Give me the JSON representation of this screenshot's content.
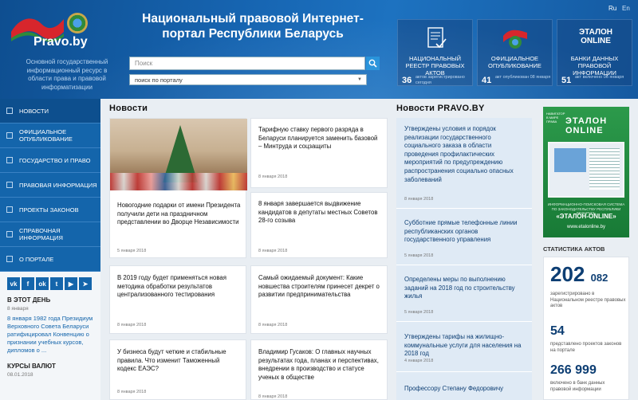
{
  "header": {
    "logo_name": "Pravo.by",
    "tagline": "Основной государственный информационный ресурс в области права и правовой информатизации",
    "title": "Национальный правовой Интернет-портал Республики Беларусь",
    "search_placeholder": "Поиск",
    "search_mode": "поиск по порталу",
    "lang_ru": "Ru",
    "lang_en": "En",
    "tiles": [
      {
        "label": "Национальный реестр правовых актов",
        "num": "36",
        "desc": "актов зарегистрировано сегодня",
        "icon": "registry-document-icon"
      },
      {
        "label": "Официальное опубликование",
        "num": "41",
        "desc": "акт опубликован 08 января",
        "icon": "official-emblem-icon"
      },
      {
        "label": "Банки данных правовой информации",
        "num": "51",
        "desc": "акт включено 06 января",
        "icon": "etalon-logo-icon",
        "logo_text": "ЭТАЛОН ONLINE"
      }
    ]
  },
  "sidebar": {
    "nav": [
      "Новости",
      "Официальное опубликование",
      "Государство и право",
      "Правовая информация",
      "Проекты законов",
      "Справочная информация",
      "О портале"
    ],
    "social": [
      "vk",
      "f",
      "ok",
      "tw",
      "yt",
      "tg"
    ],
    "today_h": "В этот день",
    "today_date": "8 января",
    "today_text": "8 января 1982 года Президиум Верховного Совета Беларуси ратифицировал Конвенцию о признании учебных курсов, дипломов о ...",
    "rates_h": "Курсы валют",
    "rates_date": "08.01.2018"
  },
  "news": {
    "heading": "Новости",
    "cards": [
      {
        "text": "Новогодние подарки от имени Президента получили дети на праздничном представлении во Дворце Независимости",
        "date": "5 января 2018"
      },
      {
        "text": "Тарифную ставку первого разряда в Беларуси планируется заменить базовой – Минтруда и соцзащиты",
        "date": "8 января 2018"
      },
      {
        "text": "8 января завершается выдвижение кандидатов в депутаты местных Советов 28-го созыва",
        "date": "8 января 2018"
      },
      {
        "text": "В 2019 году будет применяться новая методика обработки результатов централизованного тестирования",
        "date": "8 января 2018"
      },
      {
        "text": "Самый ожидаемый документ: Какие новшества строителям принесет декрет о развитии предпринимательства",
        "date": "8 января 2018"
      },
      {
        "text": "У бизнеса будут четкие и стабильные правила. Что изменит Таможенный кодекс ЕАЭС?",
        "date": "8 января 2018"
      },
      {
        "text": "Владимир Гусаков: О главных научных результатах года, планах и перспективах, внедрении в производство и статусе ученых в обществе",
        "date": "8 января 2018"
      }
    ]
  },
  "pravo_news": {
    "heading": "Новости PRAVO.BY",
    "items": [
      {
        "text": "Утверждены условия и порядок реализации государственного социального заказа в области проведения профилактических мероприятий по предупреждению распространения социально опасных заболеваний",
        "date": "8 января 2018"
      },
      {
        "text": "Субботние прямые телефонные линии республиканских органов государственного управления",
        "date": "5 января 2018"
      },
      {
        "text": "Определены меры по выполнению заданий на 2018 год по строительству жилья",
        "date": "5 января 2018"
      },
      {
        "text": "Утверждены тарифы на жилищно-коммунальные услуги для населения на 2018 год",
        "date": "4 января 2018"
      },
      {
        "text": "Профессору Степану Федоровичу",
        "date": ""
      }
    ]
  },
  "banner": {
    "vtext": "НАВИГАТОР В МИРЕ ПРАВА",
    "etalon1": "ЭТАЛОН",
    "etalon2": "ONLINE",
    "small": "ИНФОРМАЦИОННО-ПОИСКОВАЯ СИСТЕМА ПО ЗАКОНОДАТЕЛЬСТВУ РЕСПУБЛИКИ БЕЛАРУСЬ",
    "name": "«ЭТАЛОН-ONLINE»",
    "url": "www.etalonline.by"
  },
  "stats": {
    "heading": "Статистика актов",
    "acts_big": "202",
    "acts_small": "082",
    "acts_desc": "зарегистрировано в Национальном реестре правовых актов",
    "projects": "54",
    "projects_desc": "представлено проектов законов на портале",
    "bank": "266 999",
    "bank_desc": "включено в банк данных правовой информации"
  },
  "colors": {
    "header": "#1766b3",
    "nav": "#1465ab",
    "accent": "#1f8fd9",
    "pravo_news_bg": "#dfeaf5"
  }
}
